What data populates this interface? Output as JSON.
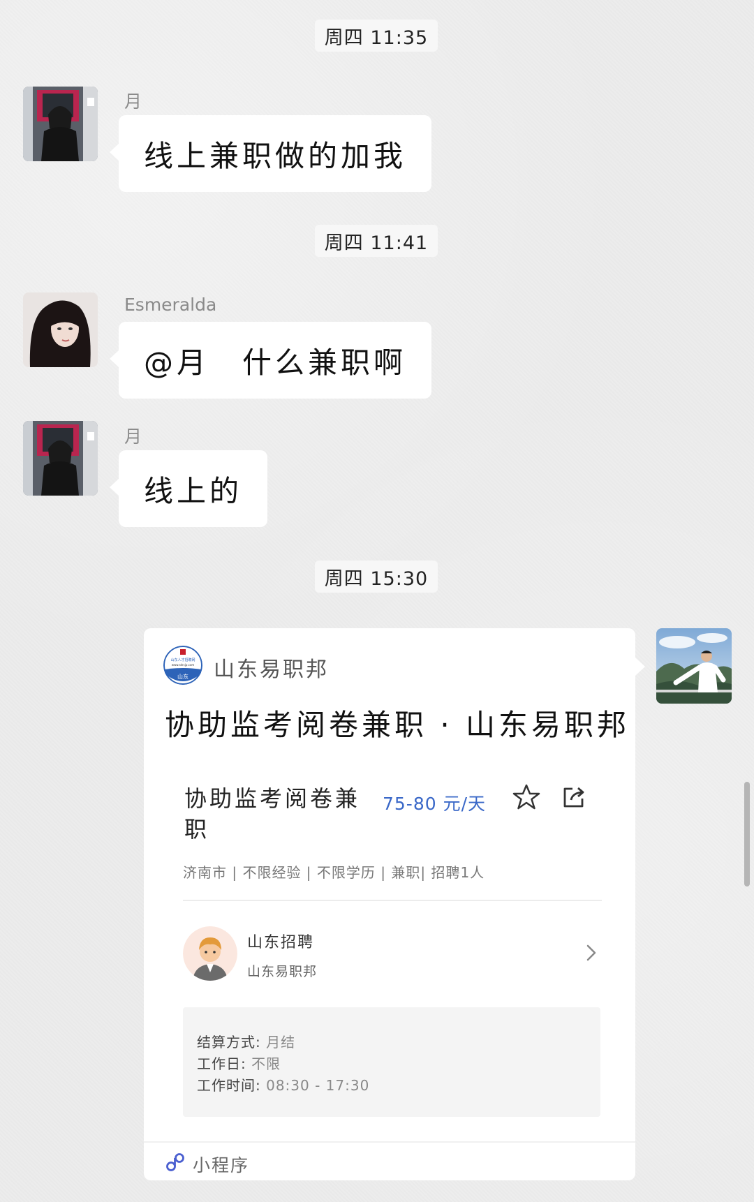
{
  "timestamps": {
    "first": "周四 11:35",
    "second": "周四 11:41",
    "third": "周四 15:30"
  },
  "messages": [
    {
      "sender": "月",
      "text": "线上兼职做的加我"
    },
    {
      "sender": "Esmeralda",
      "text": "@月　什么兼职啊"
    },
    {
      "sender": "月",
      "text": "线上的"
    }
  ],
  "card": {
    "source_name": "山东易职邦",
    "title": "协助监考阅卷兼职 · 山东易职邦",
    "job_title": "协助监考阅卷兼职",
    "salary": "75-80 元/天",
    "meta": "济南市 | 不限经验 | 不限学历 | 兼职| 招聘1人",
    "recruiter_name": "山东招聘",
    "recruiter_company": "山东易职邦",
    "settlement_label": "结算方式: ",
    "settlement_value": "月结",
    "workday_label": "工作日: ",
    "workday_value": "不限",
    "worktime_label": "工作时间: ",
    "worktime_value": "08:30 - 17:30",
    "mini_program_label": "小程序",
    "logo_text_top": "山东人才招聘网",
    "logo_text_url": "www.sdrcjp.com",
    "logo_text_bottom": "山东"
  },
  "colors": {
    "background": "#ececec",
    "bubble": "#ffffff",
    "salary": "#3a68c8",
    "info_box": "#f4f4f4"
  },
  "icons": {
    "favorite": "star-icon",
    "share": "share-icon",
    "navigate": "chevron-right-icon",
    "mini_program": "mini-program-icon"
  }
}
